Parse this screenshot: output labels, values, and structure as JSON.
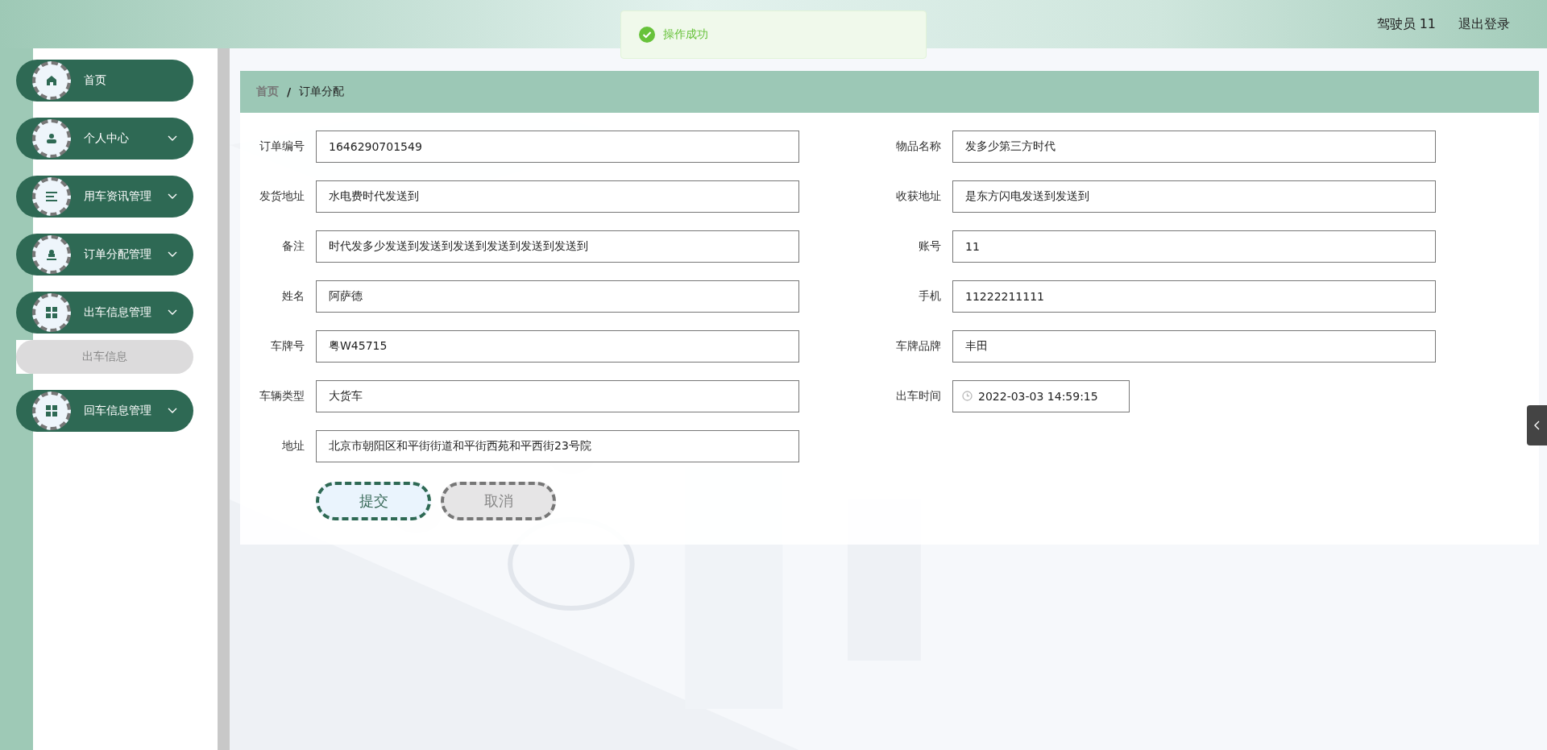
{
  "header": {
    "user": "驾驶员 11",
    "logout": "退出登录"
  },
  "toast": {
    "message": "操作成功"
  },
  "sidebar": {
    "items": [
      {
        "label": "首页",
        "kind": "home",
        "expandable": false
      },
      {
        "label": "个人中心",
        "kind": "user",
        "expandable": true
      },
      {
        "label": "用车资讯管理",
        "kind": "list",
        "expandable": true
      },
      {
        "label": "订单分配管理",
        "kind": "stamp",
        "expandable": true
      },
      {
        "label": "出车信息管理",
        "kind": "grid",
        "expandable": true,
        "expanded": true,
        "children": [
          {
            "label": "出车信息"
          }
        ]
      },
      {
        "label": "回车信息管理",
        "kind": "grid",
        "expandable": true
      }
    ]
  },
  "breadcrumb": {
    "items": [
      "首页",
      "订单分配"
    ],
    "separator": "/"
  },
  "form": {
    "left": [
      {
        "label": "订单编号",
        "value": "1646290701549",
        "kind": "text"
      },
      {
        "label": "发货地址",
        "value": "水电费时代发送到",
        "kind": "text"
      },
      {
        "label": "备注",
        "value": "时代发多少发送到发送到发送到发送到发送到发送到",
        "kind": "text"
      },
      {
        "label": "姓名",
        "value": "阿萨德",
        "kind": "text"
      },
      {
        "label": "车牌号",
        "value": "粤W45715",
        "kind": "text"
      },
      {
        "label": "车辆类型",
        "value": "大货车",
        "kind": "text"
      },
      {
        "label": "地址",
        "value": "北京市朝阳区和平街街道和平街西苑和平西街23号院",
        "kind": "text"
      }
    ],
    "right": [
      {
        "label": "物品名称",
        "value": "发多少第三方时代",
        "kind": "text"
      },
      {
        "label": "收获地址",
        "value": "是东方闪电发送到发送到",
        "kind": "text"
      },
      {
        "label": "账号",
        "value": "11",
        "kind": "text"
      },
      {
        "label": "手机",
        "value": "11222211111",
        "kind": "text"
      },
      {
        "label": "车牌品牌",
        "value": "丰田",
        "kind": "text"
      },
      {
        "label": "出车时间",
        "value": "2022-03-03 14:59:15",
        "kind": "datetime"
      }
    ],
    "buttons": [
      {
        "label": "提交",
        "kind": "primary"
      },
      {
        "label": "取消",
        "kind": "secondary"
      }
    ]
  }
}
